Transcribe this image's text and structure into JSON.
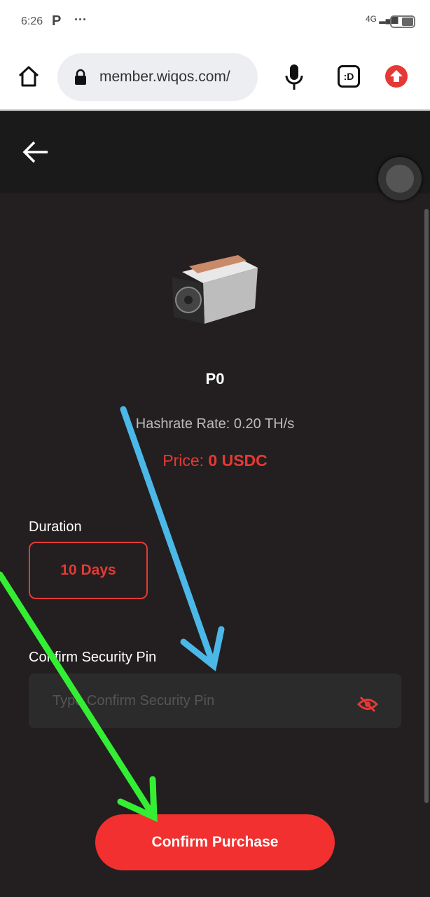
{
  "status_bar": {
    "time": "6:26",
    "app_icon": "P",
    "more": "···",
    "network": "4G"
  },
  "browser": {
    "url": "member.wiqos.com/",
    "icons": [
      "home-icon",
      "lock-icon",
      "microphone-icon",
      "extension-icon",
      "upload-icon"
    ],
    "extension_label": ":D"
  },
  "product": {
    "name": "P0",
    "hashrate": "Hashrate Rate: 0.20 TH/s",
    "price_label": "Price: ",
    "price_value": "0 USDC"
  },
  "duration": {
    "label": "Duration",
    "value": "10 Days"
  },
  "pin": {
    "label": "Confirm Security Pin",
    "placeholder": "Type Confirm Security Pin",
    "value": ""
  },
  "confirm_button": "Confirm Purchase",
  "colors": {
    "accent": "#f23030",
    "background": "#231f20",
    "arrow_blue": "#4bb8e8",
    "arrow_green": "#33ee33"
  }
}
